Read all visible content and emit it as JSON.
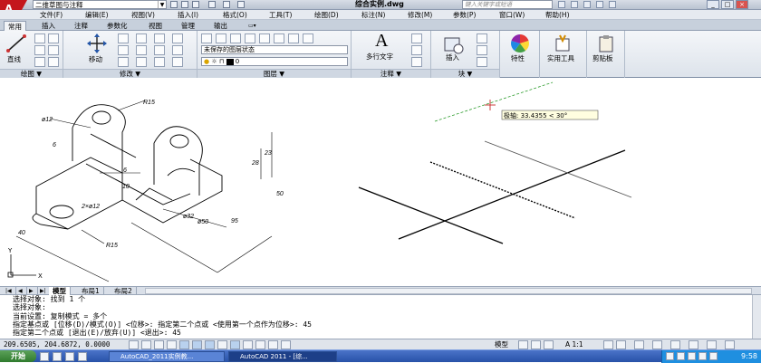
{
  "title_bar": {
    "app_letter": "A",
    "workspace": "二维草图与注释",
    "document_title": "综合实例.dwg",
    "search_placeholder": "键入关键字或短语",
    "window_buttons": {
      "minimize": "_",
      "maximize": "□",
      "close": "×"
    }
  },
  "menu": [
    "文件(F)",
    "编辑(E)",
    "视图(V)",
    "插入(I)",
    "格式(O)",
    "工具(T)",
    "绘图(D)",
    "标注(N)",
    "修改(M)",
    "参数(P)",
    "窗口(W)",
    "帮助(H)"
  ],
  "ribbon_tabs": [
    "常用",
    "插入",
    "注释",
    "参数化",
    "视图",
    "管理",
    "输出"
  ],
  "ribbon": {
    "draw": {
      "line_label": "直线",
      "panel_label": "绘图 ▼"
    },
    "modify": {
      "move_label": "移动",
      "panel_label": "修改 ▼"
    },
    "layers": {
      "layer_state": "未保存的图层状态",
      "layer_name": "0",
      "panel_label": "图层 ▼"
    },
    "annotation": {
      "multiline_text_label": "多行文字",
      "panel_label": "注释 ▼"
    },
    "block": {
      "insert_label": "插入",
      "panel_label": "块 ▼"
    },
    "properties": {
      "label": "特性"
    },
    "utilities": {
      "label": "实用工具"
    },
    "clipboard": {
      "label": "剪贴板"
    }
  },
  "drawing": {
    "dims": {
      "r15_top": "R15",
      "phi12": "ø12",
      "six_left": "6",
      "six_mid": "6",
      "r15_bottom": "R15",
      "phi32": "ø32",
      "phi50": "ø50",
      "ninety_five": "95",
      "forty": "40",
      "twenty_three": "23",
      "twenty_eight": "28",
      "fifty": "50",
      "ten": "10",
      "two_phi_small": "2×ø12"
    },
    "polar_tooltip": "极轴: 33.4355 < 30°",
    "ucs": {
      "y": "Y",
      "x": "X"
    }
  },
  "layout_tabs": [
    "模型",
    "布局1",
    "布局2"
  ],
  "command_lines": [
    "选择对象: 找到 1 个",
    "选择对象:",
    "当前设置:   复制模式 = 多个",
    "指定基点或 [位移(D)/模式(O)] <位移>: 指定第二个点或 <使用第一个点作为位移>: 45",
    "指定第二个点或 [退出(E)/放弃(U)] <退出>:  45"
  ],
  "status": {
    "coords": "209.6505, 204.6872, 0.0000",
    "model": "模型",
    "scale": "A 1:1"
  },
  "taskbar": {
    "start": "开始",
    "tasks": [
      "AutoCAD_2011实例教...",
      "AutoCAD 2011 - [综..."
    ],
    "clock": "9:58"
  },
  "colors": {
    "accent": "#c4161c",
    "tooltip_bg": "#fffee0",
    "polar_track": "#2d9c2d"
  }
}
